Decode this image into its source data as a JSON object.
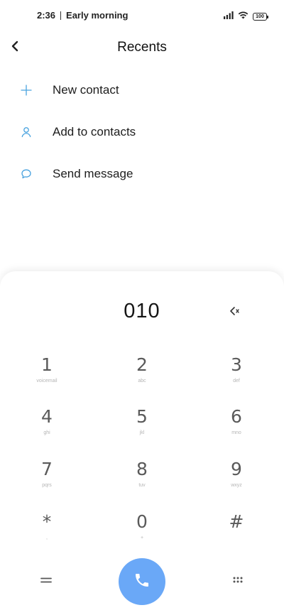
{
  "status_bar": {
    "time": "2:36",
    "note": "Early morning",
    "battery": "100"
  },
  "header": {
    "title": "Recents"
  },
  "actions": [
    {
      "label": "New contact",
      "icon": "plus-icon"
    },
    {
      "label": "Add to contacts",
      "icon": "person-icon"
    },
    {
      "label": "Send message",
      "icon": "chat-bubble-icon"
    }
  ],
  "dialer": {
    "number": "010",
    "keys": [
      {
        "digit": "1",
        "letters": "voicemail"
      },
      {
        "digit": "2",
        "letters": "abc"
      },
      {
        "digit": "3",
        "letters": "def"
      },
      {
        "digit": "4",
        "letters": "ghi"
      },
      {
        "digit": "5",
        "letters": "jkl"
      },
      {
        "digit": "6",
        "letters": "mno"
      },
      {
        "digit": "7",
        "letters": "pqrs"
      },
      {
        "digit": "8",
        "letters": "tuv"
      },
      {
        "digit": "9",
        "letters": "wxyz"
      },
      {
        "digit": "*",
        "letters": ","
      },
      {
        "digit": "0",
        "letters": "+"
      },
      {
        "digit": "#",
        "letters": ""
      }
    ]
  },
  "colors": {
    "accent": "#6aa8f7",
    "icon_blue": "#4aa3df",
    "key_digit": "#5a5a5a",
    "key_letters": "#b5b5b5"
  }
}
